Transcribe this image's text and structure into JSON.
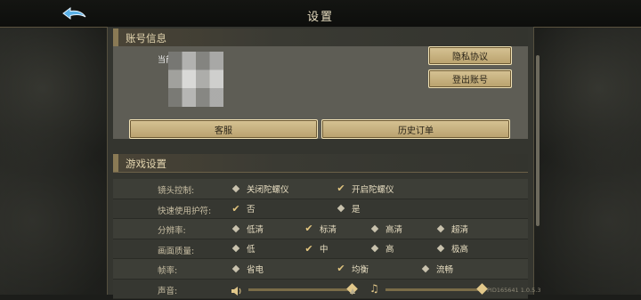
{
  "header": {
    "title": "设置"
  },
  "account": {
    "section_title": "账号信息",
    "username": "当前 641",
    "privacy_label": "隐私协议",
    "logout_label": "登出账号",
    "service_label": "客服",
    "orders_label": "历史订单"
  },
  "game": {
    "section_title": "游戏设置",
    "rows": [
      {
        "label": "镜头控制:",
        "options": [
          {
            "text": "关闭陀螺仪",
            "selected": false
          },
          {
            "text": "开启陀螺仪",
            "selected": true
          }
        ]
      },
      {
        "label": "快速使用护符:",
        "options": [
          {
            "text": "否",
            "selected": true
          },
          {
            "text": "是",
            "selected": false
          }
        ]
      },
      {
        "label": "分辨率:",
        "options": [
          {
            "text": "低清",
            "selected": false
          },
          {
            "text": "标清",
            "selected": true
          },
          {
            "text": "高清",
            "selected": false
          },
          {
            "text": "超清",
            "selected": false
          }
        ]
      },
      {
        "label": "画面质量:",
        "options": [
          {
            "text": "低",
            "selected": false
          },
          {
            "text": "中",
            "selected": true
          },
          {
            "text": "高",
            "selected": false
          },
          {
            "text": "极高",
            "selected": false
          }
        ]
      },
      {
        "label": "帧率:",
        "options": [
          {
            "text": "省电",
            "selected": false
          },
          {
            "text": "均衡",
            "selected": true
          },
          {
            "text": "流畅",
            "selected": false
          }
        ]
      },
      {
        "label": "声音:",
        "sound": true
      }
    ]
  },
  "footer": {
    "pid": "PID165641 1.0.5.3"
  },
  "colors": {
    "accent": "#d6c394",
    "panel": "#34352f"
  }
}
